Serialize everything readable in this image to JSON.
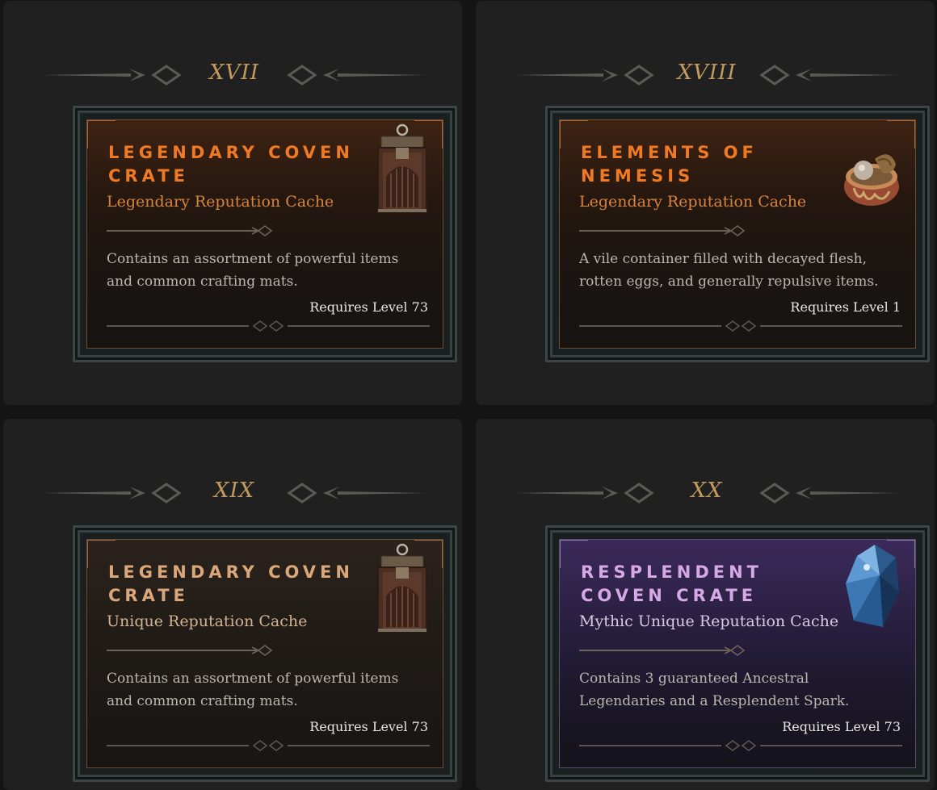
{
  "cards": [
    {
      "numeral": "XVII",
      "name": "Legendary Coven Crate",
      "type": "Legendary Reputation Cache",
      "description": "Contains an assortment of powerful items and common crafting mats.",
      "requirement": "Requires Level 73",
      "icon": "crate-icon",
      "rarity": "legendary"
    },
    {
      "numeral": "XVIII",
      "name": "Elements of Nemesis",
      "type": "Legendary Reputation Cache",
      "description": "A vile container filled with decayed flesh, rotten eggs, and generally repulsive items.",
      "requirement": "Requires Level 1",
      "icon": "bowl-icon",
      "rarity": "legendary"
    },
    {
      "numeral": "XIX",
      "name": "Legendary Coven Crate",
      "type": "Unique Reputation Cache",
      "description": "Contains an assortment of powerful items and common crafting mats.",
      "requirement": "Requires Level 73",
      "icon": "crate-icon",
      "rarity": "unique"
    },
    {
      "numeral": "XX",
      "name": "Resplendent Coven Crate",
      "type": "Mythic Unique Reputation Cache",
      "description": "Contains 3 guaranteed Ancestral Legendaries and a Resplendent Spark.",
      "requirement": "Requires Level 73",
      "icon": "crystal-icon",
      "rarity": "mythic"
    }
  ],
  "colors": {
    "legendary": "#f07a24",
    "unique": "#d9a77a",
    "mythic": "#d6a9e6",
    "numeral": "#c39a5e"
  }
}
